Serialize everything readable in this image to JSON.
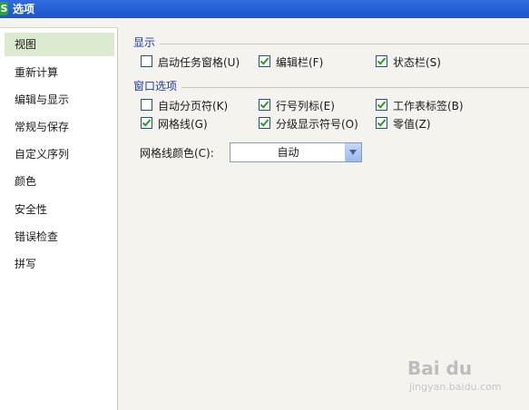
{
  "window": {
    "title": "选项",
    "icon_letter": "S"
  },
  "sidebar": {
    "items": [
      {
        "label": "视图",
        "active": true
      },
      {
        "label": "重新计算"
      },
      {
        "label": "编辑与显示"
      },
      {
        "label": "常规与保存"
      },
      {
        "label": "自定义序列"
      },
      {
        "label": "颜色"
      },
      {
        "label": "安全性"
      },
      {
        "label": "错误检查"
      },
      {
        "label": "拼写"
      }
    ]
  },
  "display": {
    "group_label": "显示",
    "options": [
      {
        "label": "启动任务窗格(U)",
        "checked": false
      },
      {
        "label": "编辑栏(F)",
        "checked": true
      },
      {
        "label": "状态栏(S)",
        "checked": true
      }
    ]
  },
  "window_options": {
    "group_label": "窗口选项",
    "options": [
      {
        "label": "自动分页符(K)",
        "checked": false
      },
      {
        "label": "行号列标(E)",
        "checked": true
      },
      {
        "label": "工作表标签(B)",
        "checked": true
      },
      {
        "label": "网格线(G)",
        "checked": true
      },
      {
        "label": "分级显示符号(O)",
        "checked": true
      },
      {
        "label": "零值(Z)",
        "checked": true
      }
    ],
    "gridline_color": {
      "label": "网格线颜色(C):",
      "value": "自动"
    }
  },
  "watermark": {
    "text": "Bai du",
    "sub": "jingyan.baidu.com"
  }
}
